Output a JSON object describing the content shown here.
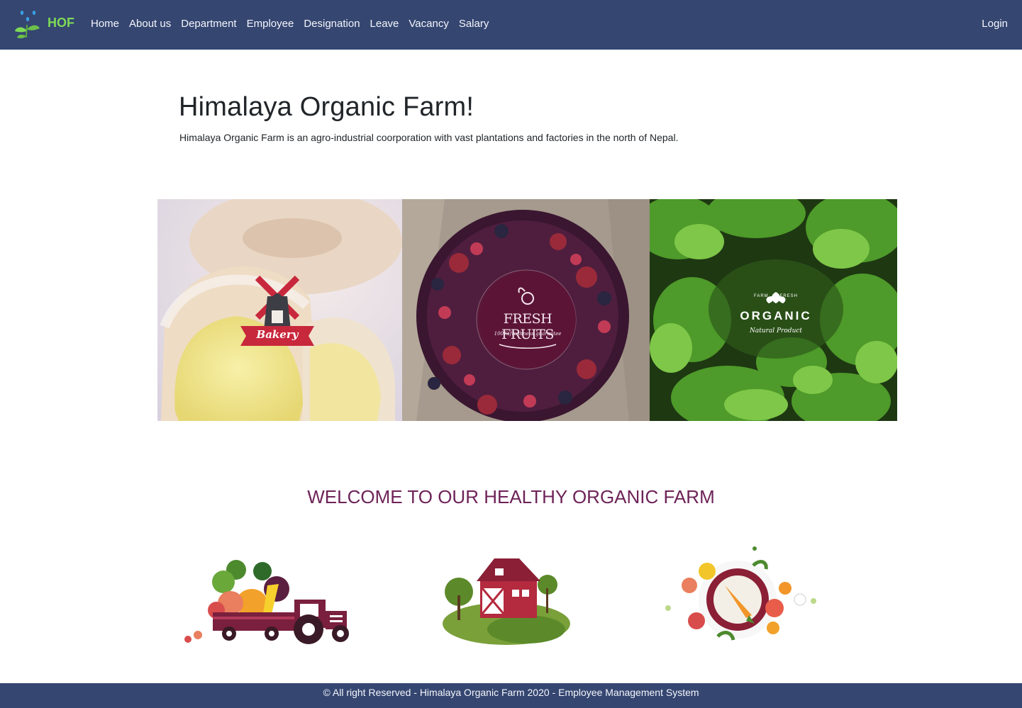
{
  "navbar": {
    "brand_text": "HOF",
    "links": [
      "Home",
      "About us",
      "Department",
      "Employee",
      "Designation",
      "Leave",
      "Vacancy",
      "Salary"
    ],
    "login_label": "Login"
  },
  "hero": {
    "title": "Himalaya Organic Farm!",
    "description": "Himalaya Organic Farm is an agro-industrial coorporation with vast plantations and factories in the north of Nepal."
  },
  "banner": {
    "panels": [
      {
        "badge_text": "Bakery",
        "icon": "windmill-badge"
      },
      {
        "badge_title": "FRESH FRUITS",
        "badge_sub": "100% freshness guarantee",
        "icon": "fruit-badge"
      },
      {
        "badge_top": "FARM      FRESH",
        "badge_title": "ORGANIC",
        "badge_sub": "Natural Product",
        "icon": "leaf-badge"
      }
    ]
  },
  "welcome": {
    "heading": "WELCOME TO OUR HEALTHY ORGANIC FARM"
  },
  "illustrations": [
    {
      "icon": "tractor-icon"
    },
    {
      "icon": "barn-icon"
    },
    {
      "icon": "vegetable-plate-icon"
    }
  ],
  "footer": {
    "text": "© All right Reserved - Himalaya Organic Farm 2020 - Employee Management System"
  },
  "colors": {
    "navbar_bg": "#354671",
    "brand_green": "#7ed957",
    "welcome_purple": "#6e2358"
  }
}
